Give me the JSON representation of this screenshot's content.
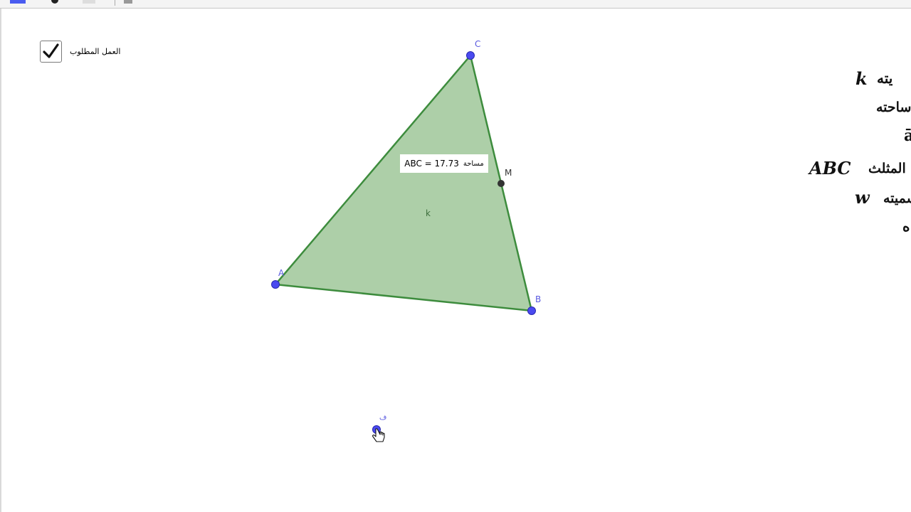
{
  "checkbox": {
    "label": "العمل المطلوب",
    "checked": true
  },
  "triangle": {
    "area_label_prefix": "مساحة",
    "area_label_value": "ABC = 17.73",
    "fill_name": "k",
    "vertices": {
      "a": "A",
      "b": "B",
      "c": "C",
      "m": "M"
    }
  },
  "free_point": {
    "label": "ف"
  },
  "side_panel": {
    "line1_text": "يته",
    "line1_math": "k",
    "line2_text": "ساحته",
    "line3_text": "ā",
    "line4_text": "المثلث",
    "line4_math": "ABC",
    "line5_text": "سميته",
    "line5_math": "w",
    "line6_text": "ه"
  },
  "colors": {
    "point": "#4a4af0",
    "triangle_fill": "#adcfa8",
    "triangle_stroke": "#3d8c3d",
    "midpoint": "#333333"
  }
}
